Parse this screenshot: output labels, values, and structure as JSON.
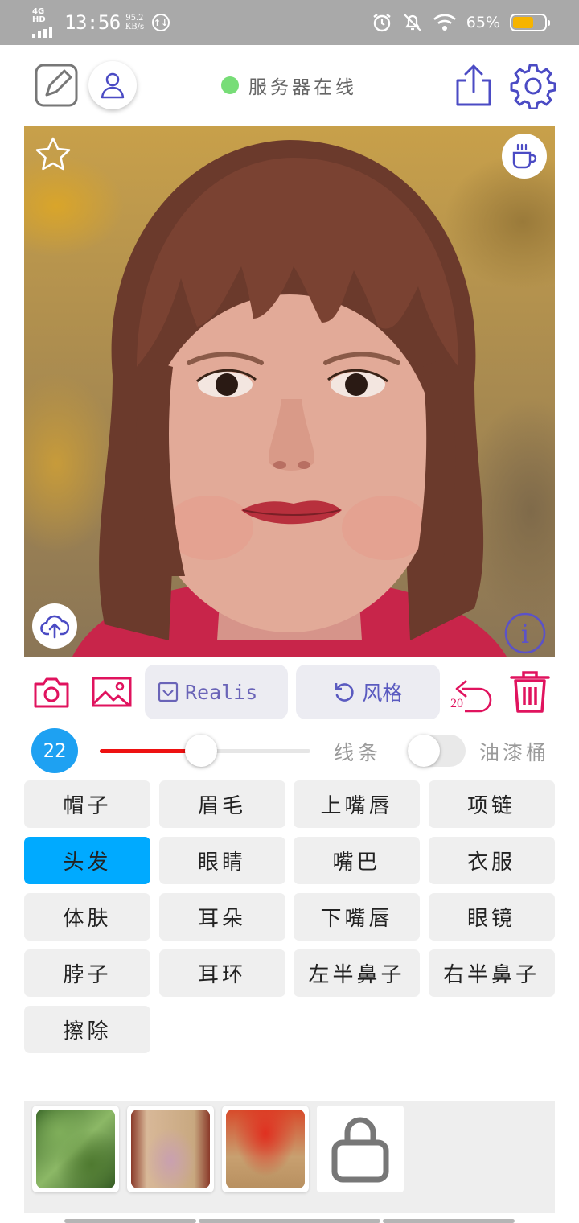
{
  "status_bar": {
    "network": "4G HD",
    "time": "13:56",
    "speed_value": "95.2",
    "speed_unit": "KB/s",
    "battery_percent": "65%",
    "battery_level": 0.65,
    "battery_color": "#f6b400"
  },
  "header": {
    "edit_icon": "edit-square-icon",
    "user_icon": "user-icon",
    "server_status_text": "服务器在线",
    "server_status_color": "#77dd77",
    "share_icon": "share-icon",
    "settings_icon": "gear-icon"
  },
  "canvas": {
    "favorite_icon": "star-icon",
    "cup_icon": "coffee-cup-icon",
    "upload_icon": "cloud-upload-icon",
    "info_icon": "info-icon",
    "info_label": "i"
  },
  "actions": {
    "camera_icon": "camera-icon",
    "gallery_icon": "image-icon",
    "model_label": "Realis",
    "style_label": "风格",
    "undo_count": "20",
    "trash_icon": "trash-icon"
  },
  "brush": {
    "size": "22",
    "slider_level": 0.48,
    "slider_color": "#ee1111",
    "line_label": "线条",
    "bucket_label": "油漆桶",
    "bucket_enabled": false
  },
  "parts": [
    {
      "label": "帽子"
    },
    {
      "label": "眉毛"
    },
    {
      "label": "上嘴唇"
    },
    {
      "label": "项链"
    },
    {
      "label": "头发",
      "selected": true
    },
    {
      "label": "眼睛"
    },
    {
      "label": "嘴巴"
    },
    {
      "label": "衣服"
    },
    {
      "label": "体肤"
    },
    {
      "label": "耳朵"
    },
    {
      "label": "下嘴唇"
    },
    {
      "label": "眼镜"
    },
    {
      "label": "脖子"
    },
    {
      "label": "耳环"
    },
    {
      "label": "左半鼻子"
    },
    {
      "label": "右半鼻子"
    },
    {
      "label": "擦除"
    }
  ],
  "selected_color": "#00aaff",
  "tray": {
    "lock_icon": "lock-icon"
  }
}
